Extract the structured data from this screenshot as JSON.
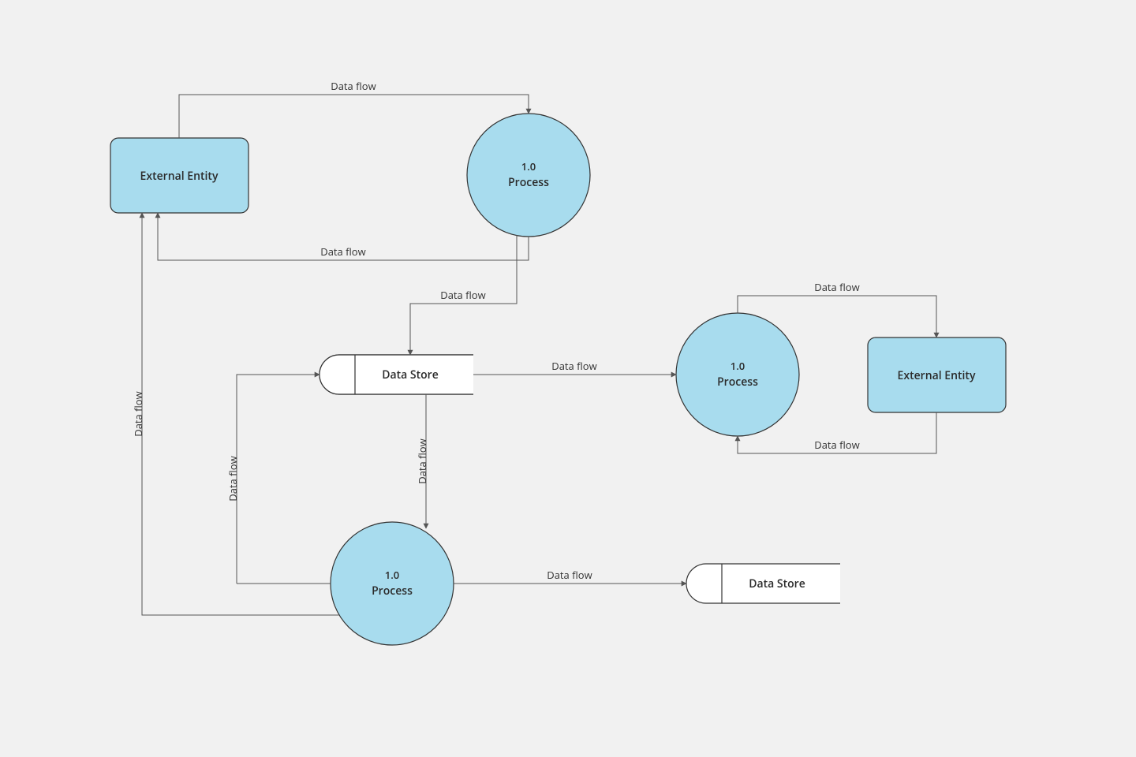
{
  "nodes": {
    "entity1": {
      "label": "External Entity"
    },
    "entity2": {
      "label": "External Entity"
    },
    "process1": {
      "num": "1.0",
      "label": "Process"
    },
    "process2": {
      "num": "1.0",
      "label": "Process"
    },
    "process3": {
      "num": "1.0",
      "label": "Process"
    },
    "store1": {
      "label": "Data Store"
    },
    "store2": {
      "label": "Data Store"
    }
  },
  "flows": {
    "f_entity1_to_process1": "Data flow",
    "f_process1_to_entity1": "Data flow",
    "f_process1_to_store1": "Data flow",
    "f_store1_to_process2": "Data flow",
    "f_process2_to_entity2": "Data flow",
    "f_entity2_to_process2": "Data flow",
    "f_store1_to_process3": "Data flow",
    "f_process3_to_store1": "Data flow",
    "f_process3_to_entity1": "Data flow",
    "f_process3_to_store2": "Data flow"
  },
  "colors": {
    "node_fill": "#a8dcee",
    "stroke": "#333333",
    "background": "#f1f1f1"
  }
}
